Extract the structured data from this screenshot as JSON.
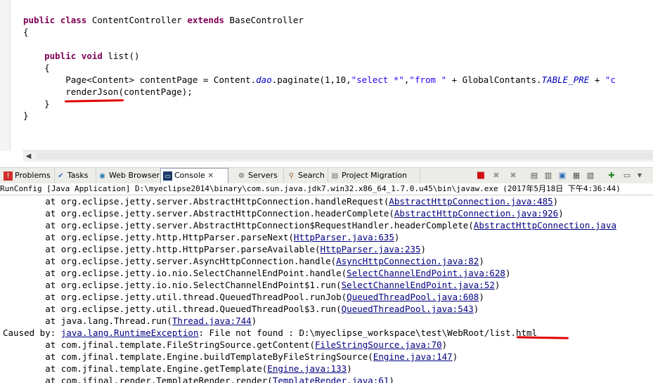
{
  "editor": {
    "l1_kw1": "public",
    "l1_kw2": "class",
    "l1_name": " ContentController ",
    "l1_kw3": "extends",
    "l1_base": " BaseController",
    "l2": "{",
    "l3_kw1": "public",
    "l3_kw2": "void",
    "l3_rest": " list()",
    "l4": "{",
    "l5_a": "Page<Content> contentPage = Content.",
    "l5_fld1": "dao",
    "l5_b": ".paginate(1,10,",
    "l5_s1": "\"select *\"",
    "l5_c": ",",
    "l5_s2": "\"from \"",
    "l5_d": " + GlobalContants.",
    "l5_fld2": "TABLE_PRE",
    "l5_e": " + ",
    "l5_s3": "\"c",
    "l6": "renderJson(contentPage);",
    "l7": "}",
    "l8": "}"
  },
  "tabs": {
    "problems": "Problems",
    "tasks": "Tasks",
    "web_browser": "Web Browser",
    "console": "Console",
    "servers": "Servers",
    "search": "Search",
    "project_migration": "Project Migration"
  },
  "console": {
    "header": "RunConfig [Java Application] D:\\myeclipse2014\\binary\\com.sun.java.jdk7.win32.x86_64_1.7.0.u45\\bin\\javaw.exe (2017年5月18日 下午4:36:44)",
    "lines": [
      {
        "pre": "        at org.eclipse.jetty.server.AbstractHttpConnection.handleRequest(",
        "link": "AbstractHttpConnection.java:485",
        "post": ")"
      },
      {
        "pre": "        at org.eclipse.jetty.server.AbstractHttpConnection.headerComplete(",
        "link": "AbstractHttpConnection.java:926",
        "post": ")"
      },
      {
        "pre": "        at org.eclipse.jetty.server.AbstractHttpConnection$RequestHandler.headerComplete(",
        "link": "AbstractHttpConnection.java",
        "post": ""
      },
      {
        "pre": "        at org.eclipse.jetty.http.HttpParser.parseNext(",
        "link": "HttpParser.java:635",
        "post": ")"
      },
      {
        "pre": "        at org.eclipse.jetty.http.HttpParser.parseAvailable(",
        "link": "HttpParser.java:235",
        "post": ")"
      },
      {
        "pre": "        at org.eclipse.jetty.server.AsyncHttpConnection.handle(",
        "link": "AsyncHttpConnection.java:82",
        "post": ")"
      },
      {
        "pre": "        at org.eclipse.jetty.io.nio.SelectChannelEndPoint.handle(",
        "link": "SelectChannelEndPoint.java:628",
        "post": ")"
      },
      {
        "pre": "        at org.eclipse.jetty.io.nio.SelectChannelEndPoint$1.run(",
        "link": "SelectChannelEndPoint.java:52",
        "post": ")"
      },
      {
        "pre": "        at org.eclipse.jetty.util.thread.QueuedThreadPool.runJob(",
        "link": "QueuedThreadPool.java:608",
        "post": ")"
      },
      {
        "pre": "        at org.eclipse.jetty.util.thread.QueuedThreadPool$3.run(",
        "link": "QueuedThreadPool.java:543",
        "post": ")"
      },
      {
        "pre": "        at java.lang.Thread.run(",
        "link": "Thread.java:744",
        "post": ")"
      },
      {
        "pre": "Caused by: ",
        "link": "java.lang.RuntimeException",
        "post": ": File not found : D:\\myeclipse_workspace\\test\\WebRoot/list.html"
      },
      {
        "pre": "        at com.jfinal.template.FileStringSource.getContent(",
        "link": "FileStringSource.java:70",
        "post": ")"
      },
      {
        "pre": "        at com.jfinal.template.Engine.buildTemplateByFileStringSource(",
        "link": "Engine.java:147",
        "post": ")"
      },
      {
        "pre": "        at com.jfinal.template.Engine.getTemplate(",
        "link": "Engine.java:133",
        "post": ")"
      },
      {
        "pre": "        at com.jfinal.render.TemplateRender.render(",
        "link": "TemplateRender.java:61",
        "post": ")"
      }
    ]
  },
  "colors": {
    "keyword": "#7f0055",
    "string": "#2a00ff",
    "field": "#0000c0",
    "link": "#000080",
    "annotation": "#e00000"
  }
}
